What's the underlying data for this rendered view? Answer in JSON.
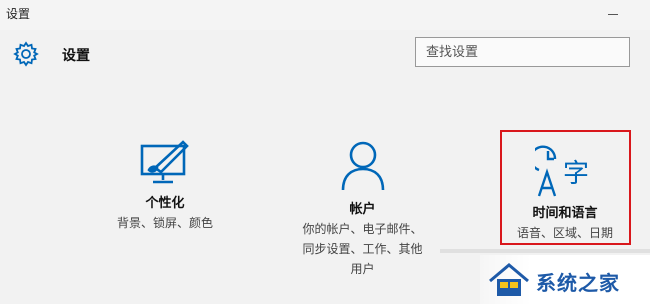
{
  "window": {
    "title": "设置"
  },
  "header": {
    "title": "设置",
    "search_placeholder": "查找设置"
  },
  "tiles": [
    {
      "name": "个性化",
      "desc_lines": [
        "背景、锁屏、颜色"
      ],
      "icon": "personalization-icon"
    },
    {
      "name": "帐户",
      "desc_lines": [
        "你的帐户、电子邮件、",
        "同步设置、工作、其他",
        "用户"
      ],
      "icon": "accounts-icon"
    },
    {
      "name": "时间和语言",
      "desc_lines": [
        "语音、区域、日期"
      ],
      "icon": "time-language-icon"
    }
  ],
  "watermark": {
    "text": "系统之家"
  },
  "colors": {
    "accent": "#0067b8",
    "highlight": "#d9171c",
    "background": "#f2f2f2"
  }
}
